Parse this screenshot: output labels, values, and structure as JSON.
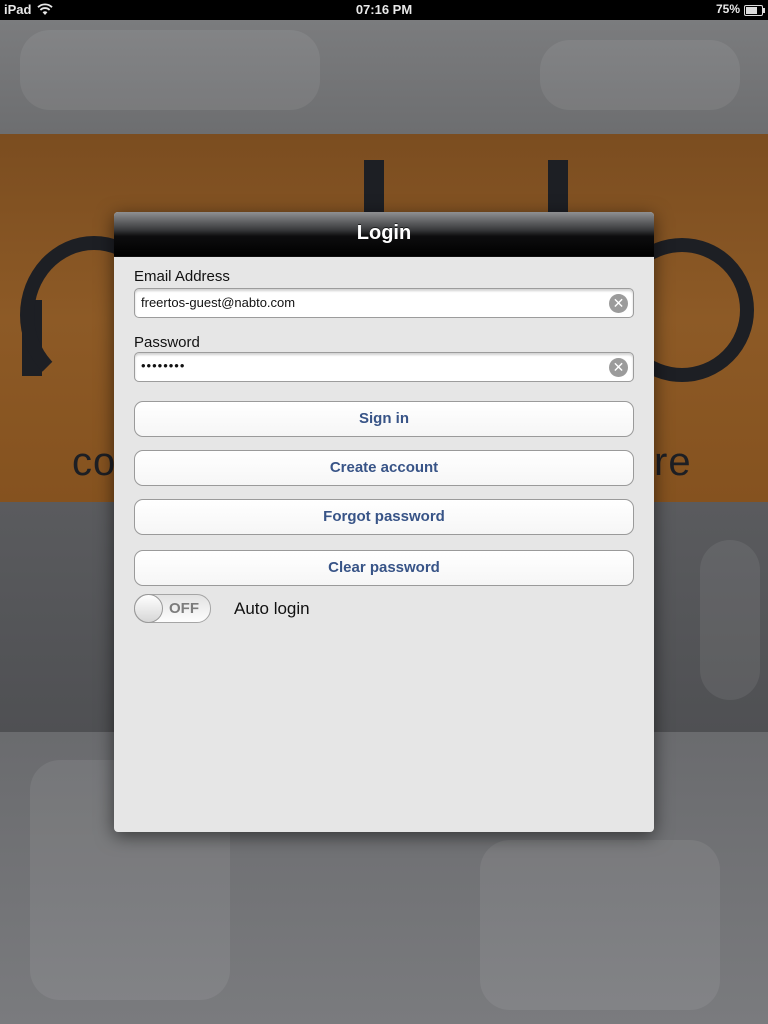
{
  "status_bar": {
    "device": "iPad",
    "time": "07:16 PM",
    "battery_percent": "75%",
    "battery_level": 0.75,
    "wifi_icon": "wifi-icon"
  },
  "background": {
    "logo_text_left": "co",
    "logo_text_right": "re"
  },
  "login": {
    "title": "Login",
    "email": {
      "label": "Email Address",
      "value": "freertos-guest@nabto.com"
    },
    "password": {
      "label": "Password",
      "value": "••••••••"
    },
    "clear_glyph": "✕",
    "buttons": {
      "sign_in": "Sign in",
      "create_account": "Create account",
      "forgot_password": "Forgot password",
      "clear_password": "Clear password"
    },
    "auto_login": {
      "state_text": "OFF",
      "label": "Auto login",
      "on": false
    }
  },
  "colors": {
    "button_text": "#385487",
    "background_orange": "#8d5a26"
  }
}
